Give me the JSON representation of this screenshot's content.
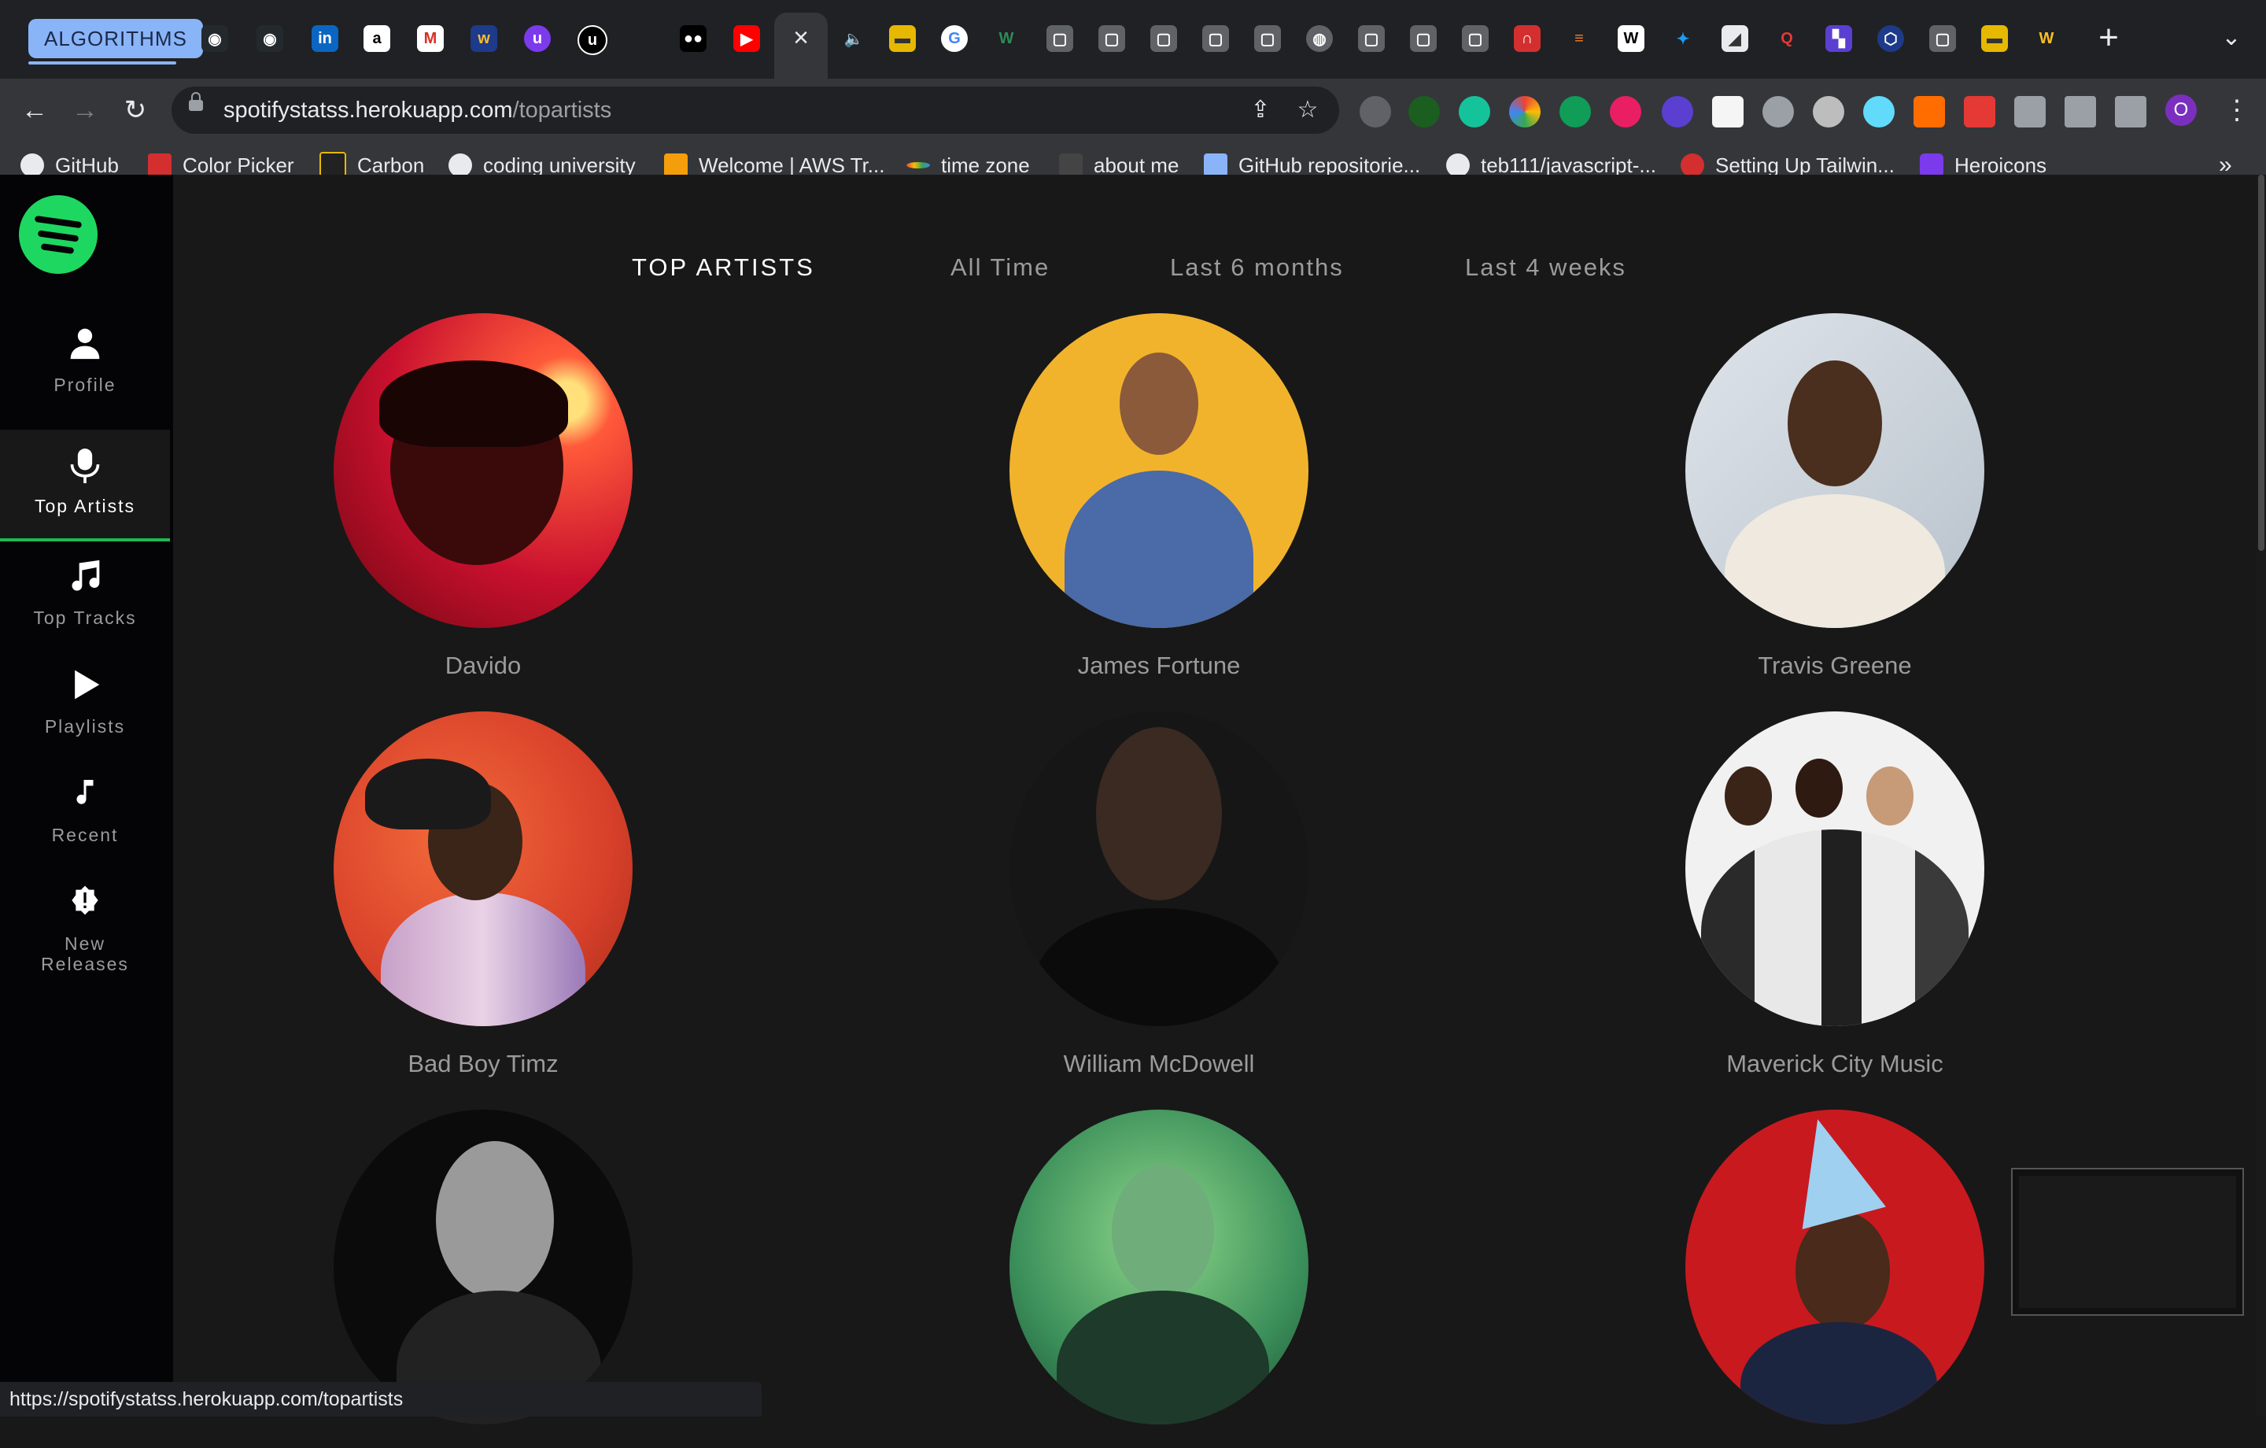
{
  "browser": {
    "tab_group_label": "ALGORITHMS",
    "url_host": "spotifystatss.herokuapp.com",
    "url_path": "/topartists",
    "status_url": "https://spotifystatss.herokuapp.com/topartists",
    "profile_initial": "O",
    "colors": {
      "tab_group": "#8ab4f8",
      "toolbar": "#35363a",
      "tabstrip": "#1f2124"
    },
    "bookmarks": [
      {
        "label": "GitHub",
        "icon": "github-icon"
      },
      {
        "label": "Color Picker",
        "icon": "color-picker-icon"
      },
      {
        "label": "Carbon",
        "icon": "carbon-icon"
      },
      {
        "label": "coding university",
        "icon": "github-icon"
      },
      {
        "label": "Welcome | AWS Tr...",
        "icon": "aws-icon"
      },
      {
        "label": "time zone",
        "icon": "timezone-icon"
      },
      {
        "label": "about me",
        "icon": "aboutme-icon"
      },
      {
        "label": "GitHub repositorie...",
        "icon": "github-repo-icon"
      },
      {
        "label": "teb111/javascript-...",
        "icon": "github-icon"
      },
      {
        "label": "Setting Up Tailwin...",
        "icon": "scrimba-icon"
      },
      {
        "label": "Heroicons",
        "icon": "heroicons-icon"
      }
    ]
  },
  "sidebar": {
    "items": [
      {
        "label": "Profile",
        "icon": "user-icon"
      },
      {
        "label": "Top Artists",
        "icon": "microphone-icon",
        "active": true
      },
      {
        "label": "Top Tracks",
        "icon": "music-note-icon"
      },
      {
        "label": "Playlists",
        "icon": "play-icon"
      },
      {
        "label": "Recent",
        "icon": "note-icon"
      },
      {
        "label": "New\nReleases",
        "icon": "alert-badge-icon"
      }
    ],
    "accent": "#1db954"
  },
  "main": {
    "title": "TOP ARTISTS",
    "ranges": [
      "All Time",
      "Last 6 months",
      "Last 4 weeks"
    ],
    "artists": [
      {
        "name": "Davido"
      },
      {
        "name": "James Fortune"
      },
      {
        "name": "Travis Greene"
      },
      {
        "name": "Bad Boy Timz"
      },
      {
        "name": "William McDowell"
      },
      {
        "name": "Maverick City Music"
      },
      {
        "name": ""
      },
      {
        "name": ""
      },
      {
        "name": ""
      }
    ]
  }
}
